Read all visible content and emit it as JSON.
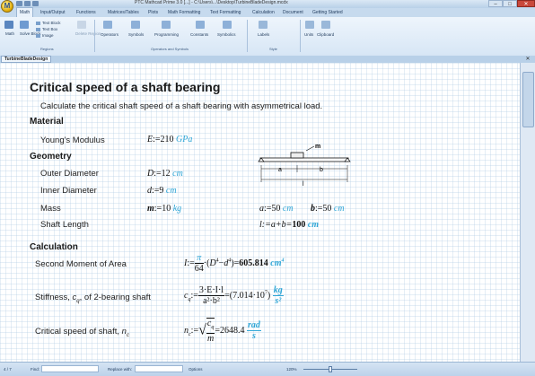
{
  "window": {
    "title": "PTC Mathcad Prime 3.0 [...] - C:\\Users\\...\\Desktop\\TurbineBladeDesign.mcdx",
    "minimize": "–",
    "maximize": "□",
    "close": "✕"
  },
  "tabs": [
    "Math",
    "Input/Output",
    "Functions",
    "Matrices/Tables",
    "Plots",
    "Math Formatting",
    "Text Formatting",
    "Calculation",
    "Document",
    "Getting Started"
  ],
  "ribbon": {
    "math_label": "Math",
    "solve_block_label": "Solve Block",
    "text_block": "Text Block",
    "text_box": "Text Box",
    "image": "Image",
    "delete_region": "Delete Region",
    "regions_group": "Regions",
    "operators": "Operators",
    "symbols": "Symbols",
    "programming": "Programming",
    "constants": "Constants",
    "symbolics": "Symbolics",
    "operators_group": "Operators and Symbols",
    "labels": "Labels",
    "style_group": "Style",
    "units": "Units",
    "clipboard": "Clipboard"
  },
  "document_tab": "TurbineBladeDesign",
  "worksheet": {
    "title": "Critical speed of a shaft bearing",
    "intro": "Calculate the critical shaft speed of a shaft bearing with asymmetrical load.",
    "material_heading": "Material",
    "youngs_label": "Young's Modulus",
    "youngs_var": "E",
    "youngs_val": "210",
    "youngs_unit": "GPa",
    "geometry_heading": "Geometry",
    "outer_label": "Outer Diameter",
    "outer_var": "D",
    "outer_val": "12",
    "outer_unit": "cm",
    "inner_label": "Inner Diameter",
    "inner_var": "d",
    "inner_val": "9",
    "inner_unit": "cm",
    "mass_label": "Mass",
    "mass_var": "m",
    "mass_val": "10",
    "mass_unit": "kg",
    "a_var": "a",
    "a_val": "50",
    "a_unit": "cm",
    "b_var": "b",
    "b_val": "50",
    "b_unit": "cm",
    "length_label": "Shaft Length",
    "length_expr": "l:=a+b=",
    "length_result": "100",
    "length_unit": "cm",
    "diagram": {
      "m": "m",
      "a": "a",
      "b": "b",
      "l": "l"
    },
    "calc_heading": "Calculation",
    "moment_label": "Second Moment of Area",
    "moment_var": "I",
    "moment_result": "605.814",
    "moment_unit": "cm",
    "moment_exp": "4",
    "stiff_label": "Stiffness, ",
    "stiff_sym": "c",
    "stiff_sub": "q",
    "stiff_label_tail": ", of 2-bearing shaft",
    "stiff_num": "3·E·I·l",
    "stiff_den": "a²·b²",
    "stiff_result": "7.014·10",
    "stiff_exp": "7",
    "stiff_unit_num": "kg",
    "stiff_unit_den": "s²",
    "crit_label": "Critical speed of shaft, ",
    "crit_sym": "n",
    "crit_sub": "c",
    "crit_result": "2648.4",
    "crit_unit_num": "rad",
    "crit_unit_den": "s"
  },
  "status": {
    "page": "4 / 7",
    "find": "Find:",
    "replace": "Replace with:",
    "options": "Options",
    "zoom": "120%"
  }
}
